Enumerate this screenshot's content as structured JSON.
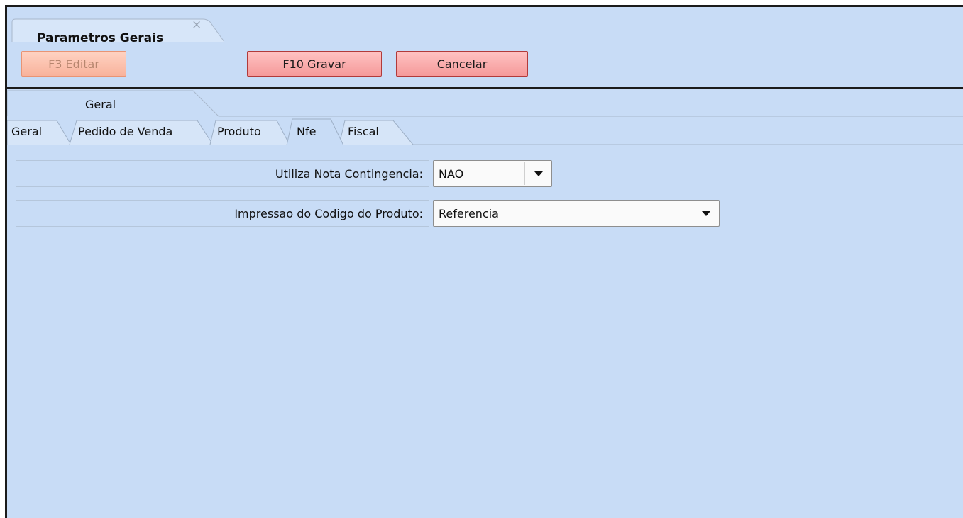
{
  "document_tab": {
    "title": "Parametros Gerais",
    "close_icon": "×"
  },
  "toolbar": {
    "editar_label": "F3 Editar",
    "gravar_label": "F10 Gravar",
    "cancelar_label": "Cancelar"
  },
  "group": {
    "label": "Geral"
  },
  "tabs": [
    {
      "label": "Geral"
    },
    {
      "label": "Pedido de Venda"
    },
    {
      "label": "Produto"
    },
    {
      "label": "Nfe",
      "active": true
    },
    {
      "label": "Fiscal"
    }
  ],
  "fields": {
    "nota_contingencia": {
      "label": "Utiliza Nota Contingencia:",
      "value": "NAO"
    },
    "impressao_codigo": {
      "label": "Impressao do Codigo do Produto:",
      "value": "Referencia"
    }
  },
  "colors": {
    "background": "#c8dcf6",
    "button_red": "#f59a9a",
    "button_disabled": "#f8b39c"
  }
}
